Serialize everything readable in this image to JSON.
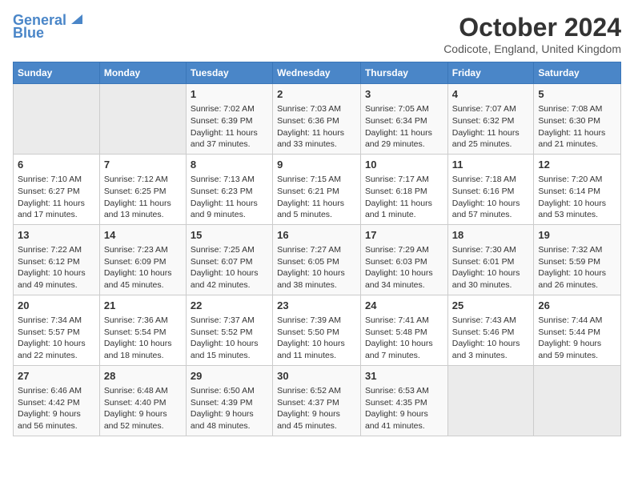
{
  "header": {
    "logo_line1": "General",
    "logo_line2": "Blue",
    "month": "October 2024",
    "location": "Codicote, England, United Kingdom"
  },
  "days_of_week": [
    "Sunday",
    "Monday",
    "Tuesday",
    "Wednesday",
    "Thursday",
    "Friday",
    "Saturday"
  ],
  "weeks": [
    [
      {
        "day": "",
        "empty": true
      },
      {
        "day": "",
        "empty": true
      },
      {
        "day": "1",
        "sunrise": "Sunrise: 7:02 AM",
        "sunset": "Sunset: 6:39 PM",
        "daylight": "Daylight: 11 hours and 37 minutes."
      },
      {
        "day": "2",
        "sunrise": "Sunrise: 7:03 AM",
        "sunset": "Sunset: 6:36 PM",
        "daylight": "Daylight: 11 hours and 33 minutes."
      },
      {
        "day": "3",
        "sunrise": "Sunrise: 7:05 AM",
        "sunset": "Sunset: 6:34 PM",
        "daylight": "Daylight: 11 hours and 29 minutes."
      },
      {
        "day": "4",
        "sunrise": "Sunrise: 7:07 AM",
        "sunset": "Sunset: 6:32 PM",
        "daylight": "Daylight: 11 hours and 25 minutes."
      },
      {
        "day": "5",
        "sunrise": "Sunrise: 7:08 AM",
        "sunset": "Sunset: 6:30 PM",
        "daylight": "Daylight: 11 hours and 21 minutes."
      }
    ],
    [
      {
        "day": "6",
        "sunrise": "Sunrise: 7:10 AM",
        "sunset": "Sunset: 6:27 PM",
        "daylight": "Daylight: 11 hours and 17 minutes."
      },
      {
        "day": "7",
        "sunrise": "Sunrise: 7:12 AM",
        "sunset": "Sunset: 6:25 PM",
        "daylight": "Daylight: 11 hours and 13 minutes."
      },
      {
        "day": "8",
        "sunrise": "Sunrise: 7:13 AM",
        "sunset": "Sunset: 6:23 PM",
        "daylight": "Daylight: 11 hours and 9 minutes."
      },
      {
        "day": "9",
        "sunrise": "Sunrise: 7:15 AM",
        "sunset": "Sunset: 6:21 PM",
        "daylight": "Daylight: 11 hours and 5 minutes."
      },
      {
        "day": "10",
        "sunrise": "Sunrise: 7:17 AM",
        "sunset": "Sunset: 6:18 PM",
        "daylight": "Daylight: 11 hours and 1 minute."
      },
      {
        "day": "11",
        "sunrise": "Sunrise: 7:18 AM",
        "sunset": "Sunset: 6:16 PM",
        "daylight": "Daylight: 10 hours and 57 minutes."
      },
      {
        "day": "12",
        "sunrise": "Sunrise: 7:20 AM",
        "sunset": "Sunset: 6:14 PM",
        "daylight": "Daylight: 10 hours and 53 minutes."
      }
    ],
    [
      {
        "day": "13",
        "sunrise": "Sunrise: 7:22 AM",
        "sunset": "Sunset: 6:12 PM",
        "daylight": "Daylight: 10 hours and 49 minutes."
      },
      {
        "day": "14",
        "sunrise": "Sunrise: 7:23 AM",
        "sunset": "Sunset: 6:09 PM",
        "daylight": "Daylight: 10 hours and 45 minutes."
      },
      {
        "day": "15",
        "sunrise": "Sunrise: 7:25 AM",
        "sunset": "Sunset: 6:07 PM",
        "daylight": "Daylight: 10 hours and 42 minutes."
      },
      {
        "day": "16",
        "sunrise": "Sunrise: 7:27 AM",
        "sunset": "Sunset: 6:05 PM",
        "daylight": "Daylight: 10 hours and 38 minutes."
      },
      {
        "day": "17",
        "sunrise": "Sunrise: 7:29 AM",
        "sunset": "Sunset: 6:03 PM",
        "daylight": "Daylight: 10 hours and 34 minutes."
      },
      {
        "day": "18",
        "sunrise": "Sunrise: 7:30 AM",
        "sunset": "Sunset: 6:01 PM",
        "daylight": "Daylight: 10 hours and 30 minutes."
      },
      {
        "day": "19",
        "sunrise": "Sunrise: 7:32 AM",
        "sunset": "Sunset: 5:59 PM",
        "daylight": "Daylight: 10 hours and 26 minutes."
      }
    ],
    [
      {
        "day": "20",
        "sunrise": "Sunrise: 7:34 AM",
        "sunset": "Sunset: 5:57 PM",
        "daylight": "Daylight: 10 hours and 22 minutes."
      },
      {
        "day": "21",
        "sunrise": "Sunrise: 7:36 AM",
        "sunset": "Sunset: 5:54 PM",
        "daylight": "Daylight: 10 hours and 18 minutes."
      },
      {
        "day": "22",
        "sunrise": "Sunrise: 7:37 AM",
        "sunset": "Sunset: 5:52 PM",
        "daylight": "Daylight: 10 hours and 15 minutes."
      },
      {
        "day": "23",
        "sunrise": "Sunrise: 7:39 AM",
        "sunset": "Sunset: 5:50 PM",
        "daylight": "Daylight: 10 hours and 11 minutes."
      },
      {
        "day": "24",
        "sunrise": "Sunrise: 7:41 AM",
        "sunset": "Sunset: 5:48 PM",
        "daylight": "Daylight: 10 hours and 7 minutes."
      },
      {
        "day": "25",
        "sunrise": "Sunrise: 7:43 AM",
        "sunset": "Sunset: 5:46 PM",
        "daylight": "Daylight: 10 hours and 3 minutes."
      },
      {
        "day": "26",
        "sunrise": "Sunrise: 7:44 AM",
        "sunset": "Sunset: 5:44 PM",
        "daylight": "Daylight: 9 hours and 59 minutes."
      }
    ],
    [
      {
        "day": "27",
        "sunrise": "Sunrise: 6:46 AM",
        "sunset": "Sunset: 4:42 PM",
        "daylight": "Daylight: 9 hours and 56 minutes."
      },
      {
        "day": "28",
        "sunrise": "Sunrise: 6:48 AM",
        "sunset": "Sunset: 4:40 PM",
        "daylight": "Daylight: 9 hours and 52 minutes."
      },
      {
        "day": "29",
        "sunrise": "Sunrise: 6:50 AM",
        "sunset": "Sunset: 4:39 PM",
        "daylight": "Daylight: 9 hours and 48 minutes."
      },
      {
        "day": "30",
        "sunrise": "Sunrise: 6:52 AM",
        "sunset": "Sunset: 4:37 PM",
        "daylight": "Daylight: 9 hours and 45 minutes."
      },
      {
        "day": "31",
        "sunrise": "Sunrise: 6:53 AM",
        "sunset": "Sunset: 4:35 PM",
        "daylight": "Daylight: 9 hours and 41 minutes."
      },
      {
        "day": "",
        "empty": true
      },
      {
        "day": "",
        "empty": true
      }
    ]
  ]
}
